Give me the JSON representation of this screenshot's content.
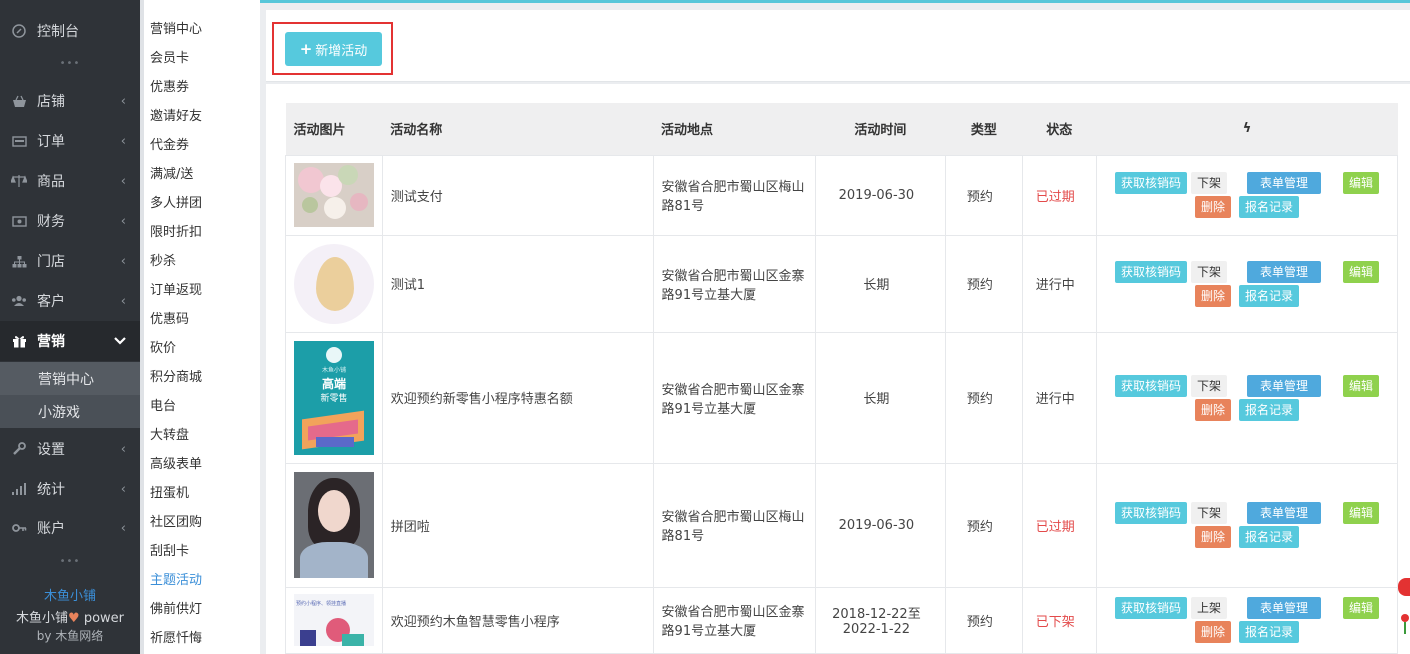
{
  "sidebar": {
    "items": [
      {
        "label": "控制台",
        "icon": "dashboard-icon"
      },
      {
        "label": "店铺",
        "icon": "shop-icon"
      },
      {
        "label": "订单",
        "icon": "order-icon"
      },
      {
        "label": "商品",
        "icon": "scale-icon"
      },
      {
        "label": "财务",
        "icon": "money-icon"
      },
      {
        "label": "门店",
        "icon": "sitemap-icon"
      },
      {
        "label": "客户",
        "icon": "users-icon"
      },
      {
        "label": "营销",
        "icon": "gift-icon"
      },
      {
        "label": "设置",
        "icon": "wrench-icon"
      },
      {
        "label": "统计",
        "icon": "bar-chart-icon"
      },
      {
        "label": "账户",
        "icon": "key-icon"
      }
    ],
    "active_label": "营销",
    "submenu": [
      "营销中心",
      "小游戏"
    ],
    "brand_name": "木鱼小铺",
    "powered": "木鱼小铺",
    "power_word": "power",
    "by_line": "by 木鱼网络"
  },
  "subnav": {
    "items": [
      "营销中心",
      "会员卡",
      "优惠券",
      "邀请好友",
      "代金券",
      "满减/送",
      "多人拼团",
      "限时折扣",
      "秒杀",
      "订单返现",
      "优惠码",
      "砍价",
      "积分商城",
      "电台",
      "大转盘",
      "高级表单",
      "扭蛋机",
      "社区团购",
      "刮刮卡",
      "主题活动",
      "佛前供灯",
      "祈愿忏悔"
    ],
    "current": "主题活动"
  },
  "toolbar": {
    "add_label": "新增活动"
  },
  "table": {
    "headers": [
      "活动图片",
      "活动名称",
      "活动地点",
      "活动时间",
      "类型",
      "状态",
      "ϟ"
    ],
    "rows": [
      {
        "name": "测试支付",
        "place": "安徽省合肥市蜀山区梅山路81号",
        "time": "2019-06-30",
        "type": "预约",
        "status": "已过期",
        "status_color": "#e34a4a",
        "shelf": "下架"
      },
      {
        "name": "测试1",
        "place": "安徽省合肥市蜀山区金寨路91号立基大厦",
        "time": "长期",
        "type": "预约",
        "status": "进行中",
        "status_color": "#444444",
        "shelf": "下架"
      },
      {
        "name": "欢迎预约新零售小程序特惠名额",
        "place": "安徽省合肥市蜀山区金寨路91号立基大厦",
        "time": "长期",
        "type": "预约",
        "status": "进行中",
        "status_color": "#444444",
        "shelf": "下架"
      },
      {
        "name": "拼团啦",
        "place": "安徽省合肥市蜀山区梅山路81号",
        "time": "2019-06-30",
        "type": "预约",
        "status": "已过期",
        "status_color": "#e34a4a",
        "shelf": "下架"
      },
      {
        "name": "欢迎预约木鱼智慧零售小程序",
        "place": "安徽省合肥市蜀山区金寨路91号立基大厦",
        "time_line1": "2018-12-22至",
        "time_line2": "2022-1-22",
        "type": "预约",
        "status": "已下架",
        "status_color": "#e34a4a",
        "shelf": "上架"
      }
    ],
    "ops": {
      "verify": "获取核销码",
      "form": "表单管理",
      "edit": "编辑",
      "delete": "删除",
      "log": "报名记录"
    },
    "poster": {
      "brand": "木鱼小铺",
      "title1": "高端",
      "title2": "新零售"
    },
    "last_thumb_text": "预约小程序、领挂直播"
  }
}
